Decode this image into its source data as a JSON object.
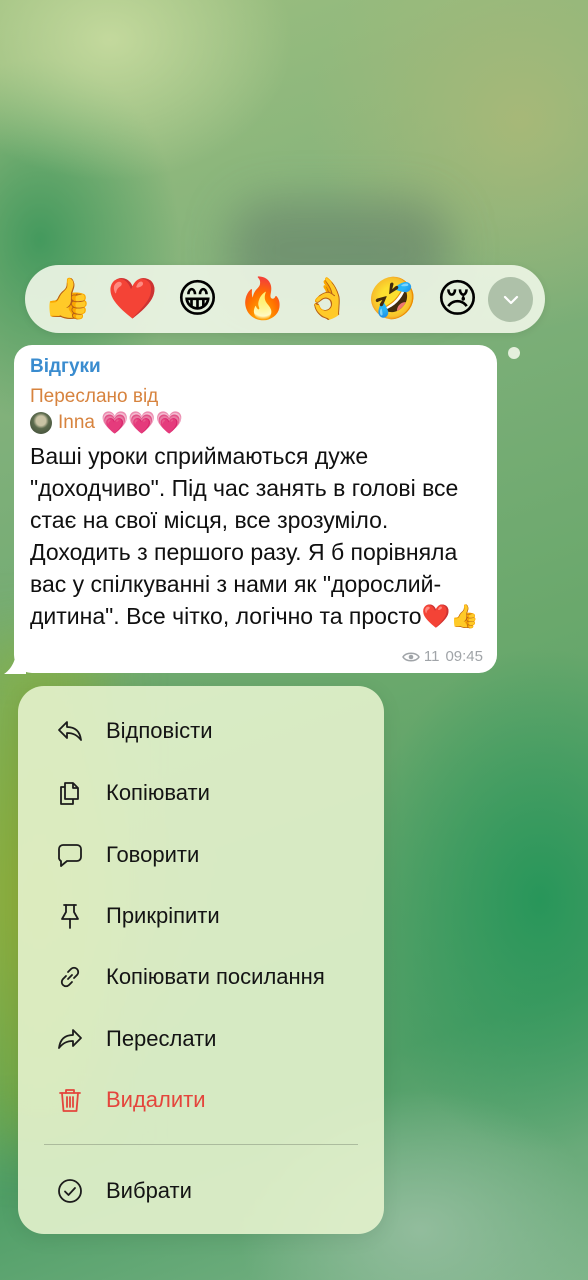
{
  "reactions": [
    "👍",
    "❤️",
    "😁",
    "🔥",
    "👌",
    "🤣",
    "😢"
  ],
  "expand_icon": "chevron-down-icon",
  "message": {
    "channel": "Відгуки",
    "forwarded_label": "Переслано від",
    "author": "Inna",
    "author_emojis": "💗💗💗",
    "text": "Ваші уроки сприймаються дуже \"доходчиво\". Під час занять в голові все стає на свої місця, все зрозуміло. Доходить з першого разу. Я б порівняла вас у спілкуванні з нами як \"дорослий-дитина\". Все чітко, логічно та просто❤️👍",
    "views": "11",
    "time": "09:45"
  },
  "menu": {
    "items": [
      {
        "label": "Відповісти",
        "icon": "reply-icon"
      },
      {
        "label": "Копіювати",
        "icon": "copy-icon"
      },
      {
        "label": "Говорити",
        "icon": "speech-bubble-icon"
      },
      {
        "label": "Прикріпити",
        "icon": "pin-icon"
      },
      {
        "label": "Копіювати посилання",
        "icon": "link-icon"
      },
      {
        "label": "Переслати",
        "icon": "forward-icon"
      },
      {
        "label": "Видалити",
        "icon": "trash-icon"
      }
    ],
    "select_label": "Вибрати",
    "select_icon": "checkmark-circle-icon"
  },
  "colors": {
    "channel": "#3a8ccf",
    "forwarded": "#d7833e",
    "danger": "#e4453c",
    "meta": "#a0a4a8"
  }
}
